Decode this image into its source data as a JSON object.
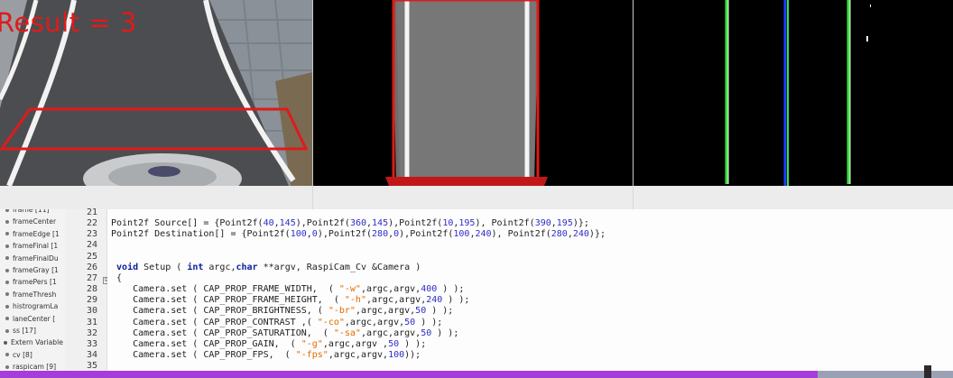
{
  "camera": {
    "result_label": "Result = 3"
  },
  "symbols": {
    "items": [
      {
        "label": "frame [11]",
        "level": 1
      },
      {
        "label": "frameCenter",
        "level": 1
      },
      {
        "label": "frameEdge [1",
        "level": 1
      },
      {
        "label": "frameFinal [1",
        "level": 1
      },
      {
        "label": "frameFinalDu",
        "level": 1
      },
      {
        "label": "frameGray [1",
        "level": 1
      },
      {
        "label": "framePers [1",
        "level": 1
      },
      {
        "label": "frameThresh",
        "level": 1
      },
      {
        "label": "histrogramLa",
        "level": 1
      },
      {
        "label": "laneCenter [",
        "level": 1
      },
      {
        "label": "ss [17]",
        "level": 1
      },
      {
        "label": "Extern Variable",
        "level": 0
      },
      {
        "label": "cv [8]",
        "level": 1
      },
      {
        "label": "raspicam [9]",
        "level": 1
      }
    ]
  },
  "editor": {
    "lines": [
      {
        "n": "21",
        "segments": []
      },
      {
        "n": "22",
        "segments": [
          {
            "t": "Point2f Source[] = {Point2f("
          },
          {
            "t": "40",
            "c": "num"
          },
          {
            "t": ","
          },
          {
            "t": "145",
            "c": "num"
          },
          {
            "t": "),Point2f("
          },
          {
            "t": "360",
            "c": "num"
          },
          {
            "t": ","
          },
          {
            "t": "145",
            "c": "num"
          },
          {
            "t": "),Point2f("
          },
          {
            "t": "10",
            "c": "num"
          },
          {
            "t": ","
          },
          {
            "t": "195",
            "c": "num"
          },
          {
            "t": "), Point2f("
          },
          {
            "t": "390",
            "c": "num"
          },
          {
            "t": ","
          },
          {
            "t": "195",
            "c": "num"
          },
          {
            "t": ")};"
          }
        ]
      },
      {
        "n": "23",
        "segments": [
          {
            "t": "Point2f Destination[] = {Point2f("
          },
          {
            "t": "100",
            "c": "num"
          },
          {
            "t": ","
          },
          {
            "t": "0",
            "c": "num"
          },
          {
            "t": "),Point2f("
          },
          {
            "t": "280",
            "c": "num"
          },
          {
            "t": ","
          },
          {
            "t": "0",
            "c": "num"
          },
          {
            "t": "),Point2f("
          },
          {
            "t": "100",
            "c": "num"
          },
          {
            "t": ","
          },
          {
            "t": "240",
            "c": "num"
          },
          {
            "t": "), Point2f("
          },
          {
            "t": "280",
            "c": "num"
          },
          {
            "t": ","
          },
          {
            "t": "240",
            "c": "num"
          },
          {
            "t": ")};"
          }
        ]
      },
      {
        "n": "24",
        "segments": []
      },
      {
        "n": "25",
        "segments": []
      },
      {
        "n": "26",
        "segments": [
          {
            "t": " "
          },
          {
            "t": "void",
            "c": "kw"
          },
          {
            "t": " Setup ( "
          },
          {
            "t": "int",
            "c": "kw"
          },
          {
            "t": " argc,"
          },
          {
            "t": "char",
            "c": "kw"
          },
          {
            "t": " **argv, RaspiCam_Cv &Camera )"
          }
        ]
      },
      {
        "n": "27",
        "segments": [
          {
            "t": " {"
          }
        ]
      },
      {
        "n": "28",
        "segments": [
          {
            "t": "    Camera.set ( CAP_PROP_FRAME_WIDTH,  ( "
          },
          {
            "t": "\"-w\"",
            "c": "str"
          },
          {
            "t": ",argc,argv,"
          },
          {
            "t": "400",
            "c": "num"
          },
          {
            "t": " ) );"
          }
        ]
      },
      {
        "n": "29",
        "segments": [
          {
            "t": "    Camera.set ( CAP_PROP_FRAME_HEIGHT,  ( "
          },
          {
            "t": "\"-h\"",
            "c": "str"
          },
          {
            "t": ",argc,argv,"
          },
          {
            "t": "240",
            "c": "num"
          },
          {
            "t": " ) );"
          }
        ]
      },
      {
        "n": "30",
        "segments": [
          {
            "t": "    Camera.set ( CAP_PROP_BRIGHTNESS, ( "
          },
          {
            "t": "\"-br\"",
            "c": "str"
          },
          {
            "t": ",argc,argv,"
          },
          {
            "t": "50",
            "c": "num"
          },
          {
            "t": " ) );"
          }
        ]
      },
      {
        "n": "31",
        "segments": [
          {
            "t": "    Camera.set ( CAP_PROP_CONTRAST ,( "
          },
          {
            "t": "\"-co\"",
            "c": "str"
          },
          {
            "t": ",argc,argv,"
          },
          {
            "t": "50",
            "c": "num"
          },
          {
            "t": " ) );"
          }
        ]
      },
      {
        "n": "32",
        "segments": [
          {
            "t": "    Camera.set ( CAP_PROP_SATURATION,  ( "
          },
          {
            "t": "\"-sa\"",
            "c": "str"
          },
          {
            "t": ",argc,argv,"
          },
          {
            "t": "50",
            "c": "num"
          },
          {
            "t": " ) );"
          }
        ]
      },
      {
        "n": "33",
        "segments": [
          {
            "t": "    Camera.set ( CAP_PROP_GAIN,  ( "
          },
          {
            "t": "\"-g\"",
            "c": "str"
          },
          {
            "t": ",argc,argv ,"
          },
          {
            "t": "50",
            "c": "num"
          },
          {
            "t": " ) );"
          }
        ]
      },
      {
        "n": "34",
        "segments": [
          {
            "t": "    Camera.set ( CAP_PROP_FPS,  ( "
          },
          {
            "t": "\"-fps\"",
            "c": "str"
          },
          {
            "t": ",argc,argv,"
          },
          {
            "t": "100",
            "c": "num"
          },
          {
            "t": "));"
          }
        ]
      },
      {
        "n": "35",
        "segments": []
      }
    ]
  },
  "playback": {
    "progress": 0.858
  },
  "colors": {
    "red_overlay": "#e01a1a",
    "lane_green": "#3ee03e",
    "lane_blue": "#1f3cff",
    "progress_fill": "#a73cdc"
  }
}
